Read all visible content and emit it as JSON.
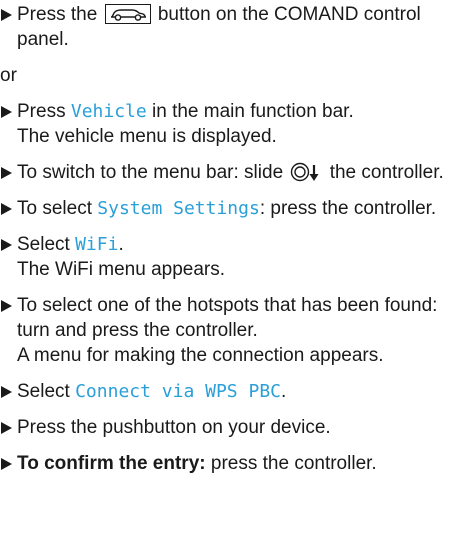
{
  "steps": [
    {
      "parts": {
        "a": "Press the ",
        "icon": "car-button-icon",
        "b": " button on the COMAND control panel."
      }
    },
    {
      "or": "or"
    },
    {
      "parts": {
        "a": "Press ",
        "display": "Vehicle",
        "b": " in the main function bar.",
        "line2": "The vehicle menu is displayed."
      }
    },
    {
      "parts": {
        "a": "To switch to the menu bar: slide ",
        "icon": "controller-slide-down-icon",
        "b": " the controller."
      }
    },
    {
      "parts": {
        "a": "To select ",
        "display": "System Settings",
        "b": ": press the controller."
      }
    },
    {
      "parts": {
        "a": "Select ",
        "display": "WiFi",
        "b": ".",
        "line2": "The WiFi menu appears."
      }
    },
    {
      "parts": {
        "a": "To select one of the hotspots that has been found: turn and press the controller.",
        "line2": "A menu for making the connection appears."
      }
    },
    {
      "parts": {
        "a": "Select ",
        "display": "Connect via WPS PBC",
        "b": "."
      }
    },
    {
      "parts": {
        "a": "Press the pushbutton on your device."
      }
    },
    {
      "parts": {
        "bold": "To confirm the entry:",
        "a": " press the controller."
      }
    }
  ],
  "colors": {
    "display_text": "#2a9fd8",
    "body_text": "#1a1a1a"
  }
}
